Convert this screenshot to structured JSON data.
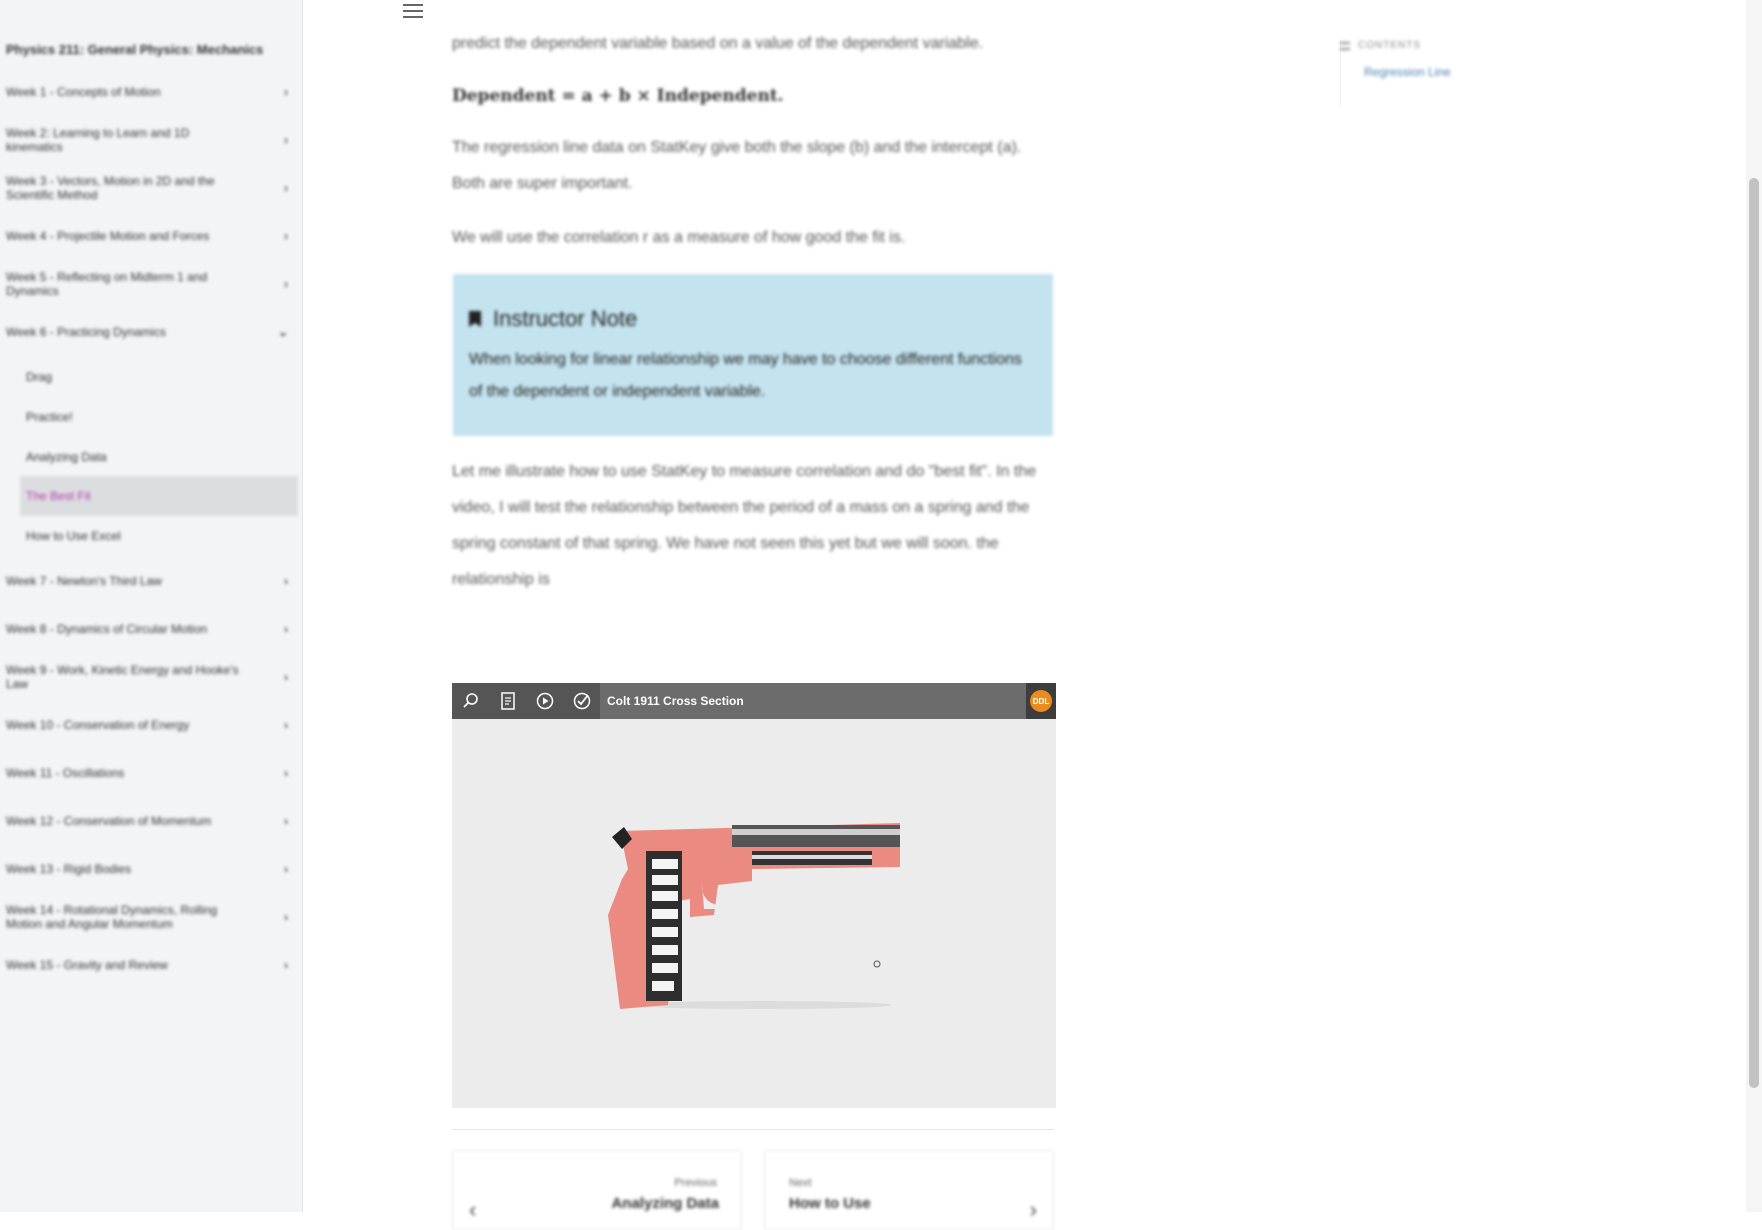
{
  "sidebar": {
    "book_title": "Physics 211: General Physics: Mechanics",
    "weeks_top": [
      {
        "label": "Week 1 - Concepts of Motion",
        "chevron": "›"
      },
      {
        "label": "Week 2: Learning to Learn and 1D kinematics",
        "chevron": "›"
      },
      {
        "label": "Week 3 - Vectors, Motion in 2D and the Scientific Method",
        "chevron": "›"
      },
      {
        "label": "Week 4 - Projectile Motion and Forces",
        "chevron": "›"
      },
      {
        "label": "Week 5 - Reflecting on Midterm 1 and Dynamics",
        "chevron": "›"
      },
      {
        "label": "Week 6 - Practicing Dynamics",
        "chevron": "⌄"
      }
    ],
    "subitems": [
      {
        "label": "Drag"
      },
      {
        "label": "Practice!"
      },
      {
        "label": "Analyzing Data"
      },
      {
        "label": "The Best Fit"
      },
      {
        "label": "How to Use Excel"
      }
    ],
    "weeks_bottom": [
      {
        "label": "Week 7 - Newton's Third Law",
        "chevron": "›"
      },
      {
        "label": "Week 8 - Dynamics of Circular Motion",
        "chevron": "›"
      },
      {
        "label": "Week 9 - Work, Kinetic Energy and Hooke's Law",
        "chevron": "›"
      },
      {
        "label": "Week 10 - Conservation of Energy",
        "chevron": "›"
      },
      {
        "label": "Week 11 - Oscillations",
        "chevron": "›"
      },
      {
        "label": "Week 12 - Conservation of Momentum",
        "chevron": "›"
      },
      {
        "label": "Week 13 - Rigid Bodies",
        "chevron": "›"
      },
      {
        "label": "Week 14 - Rotational Dynamics, Rolling Motion and Angular Momentum",
        "chevron": "›"
      },
      {
        "label": "Week 15 - Gravity and Review",
        "chevron": "›"
      }
    ]
  },
  "article": {
    "para_top": "predict the dependent variable based on a value of the dependent variable.",
    "formula": "Dependent = a + b × Independent.",
    "para_slope": "The regression line data on StatKey give both the slope (b) and the intercept (a). Both are super important.",
    "para_corr": "We will use the correlation r as a measure of how good the fit is.",
    "note_title": "Instructor Note",
    "note_body": "When looking for linear relationship we may have to choose different functions of the dependent or independent variable.",
    "para_video": "Let me illustrate how to use StatKey to measure correlation and do \"best fit\". In the video, I will test the relationship between the period of a mass on a spring and the spring constant of that spring. We have not seen this yet but we will soon. the relationship is"
  },
  "viewer": {
    "title": "Colt 1911 Cross Section",
    "logo_text": "DDL",
    "buttons": [
      "search-icon",
      "document-icon",
      "play-icon",
      "check-circle-icon"
    ]
  },
  "pager": {
    "prev_small": "Previous",
    "prev_title": "Analyzing Data",
    "next_small": "Next",
    "next_title": "How to Use"
  },
  "toc": {
    "heading": "CONTENTS",
    "link": "Regression Line"
  }
}
